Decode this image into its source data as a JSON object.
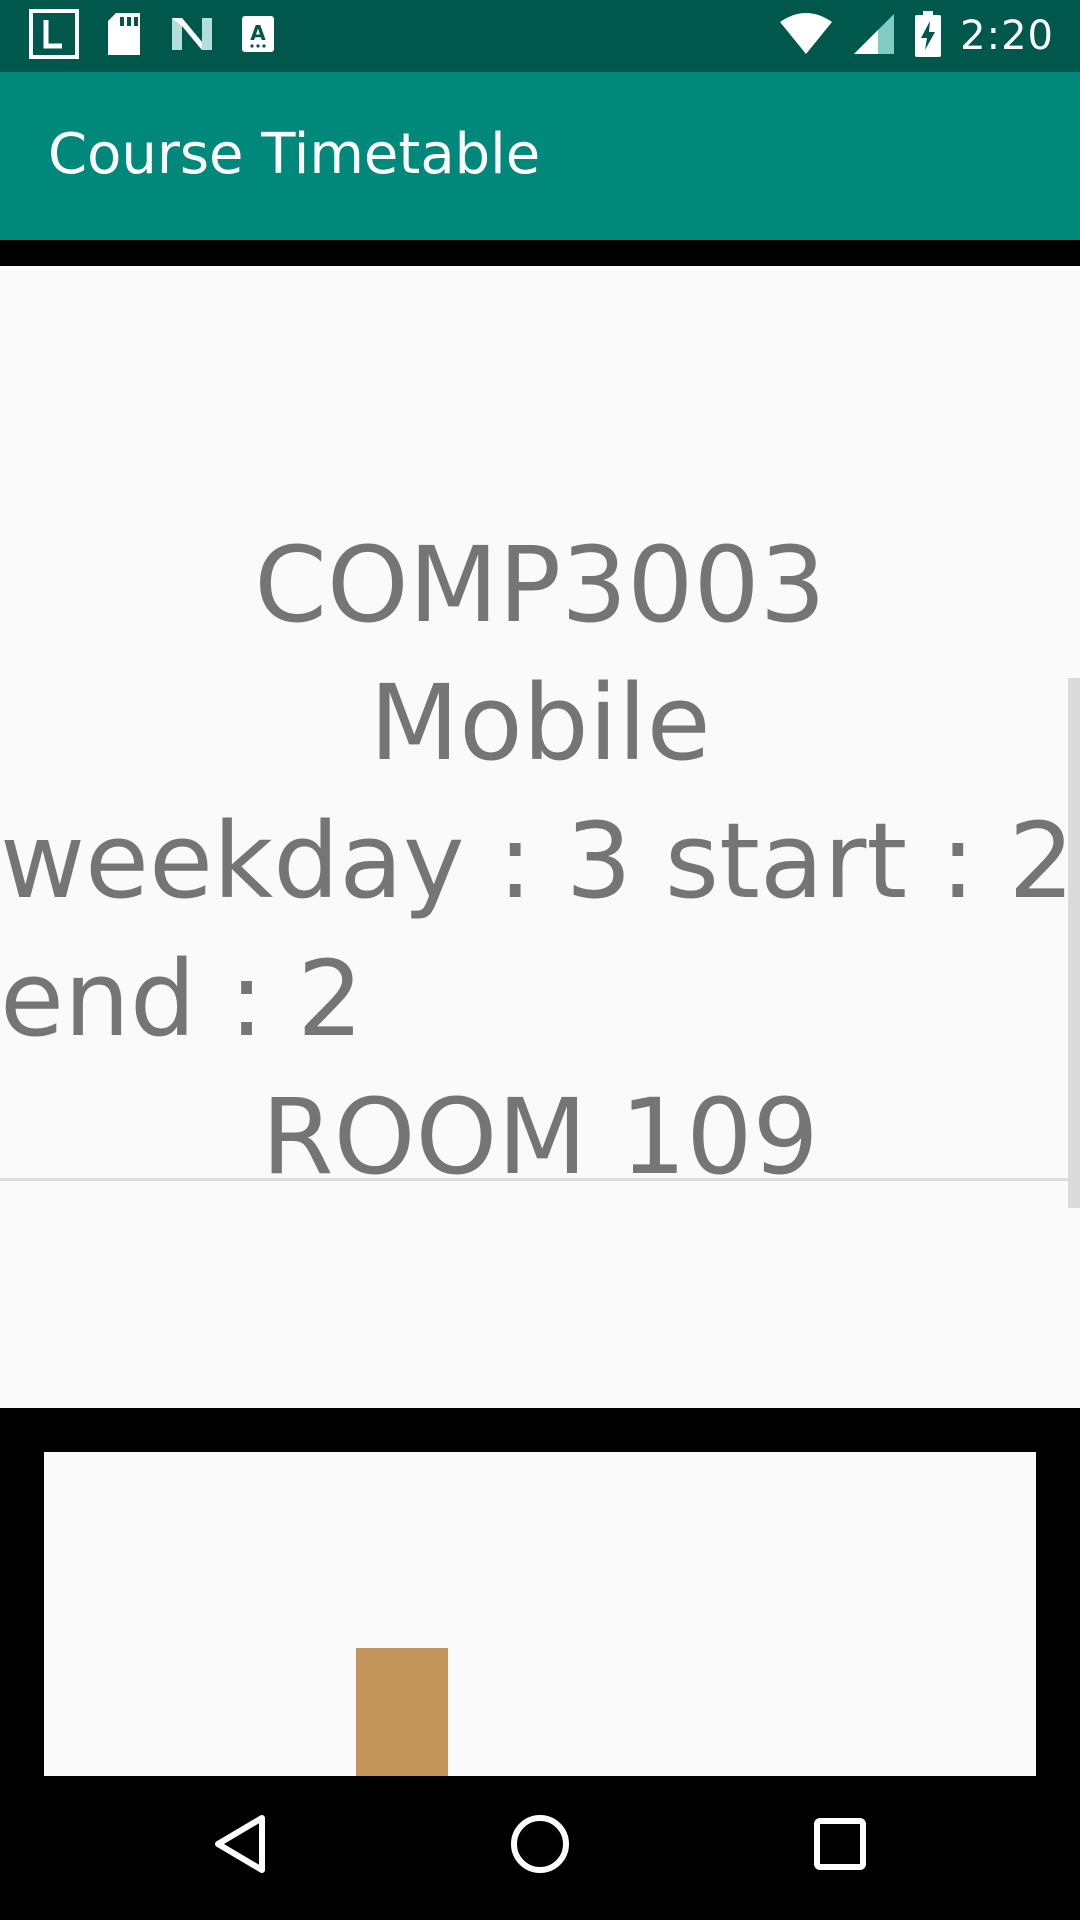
{
  "status_bar": {
    "time": "2:20",
    "left_icons": [
      "launcher-l-icon",
      "sd-card-icon",
      "n-logo-icon",
      "text-a-icon"
    ],
    "right_icons": [
      "wifi-icon",
      "cellular-signal-icon",
      "battery-charging-icon"
    ]
  },
  "app_bar": {
    "title": "Course Timetable"
  },
  "course": {
    "code": "COMP3003",
    "name": "Mobile",
    "schedule_line1": "weekday : 3 start : 2",
    "schedule_line2": "end : 2",
    "room": "ROOM 109"
  },
  "colors": {
    "status_bar": "#00574B",
    "app_bar": "#00897B",
    "text_gray": "#757575",
    "block": "#C4955B"
  },
  "nav_bar": {
    "icons": [
      "back-icon",
      "home-icon",
      "recents-icon"
    ]
  }
}
